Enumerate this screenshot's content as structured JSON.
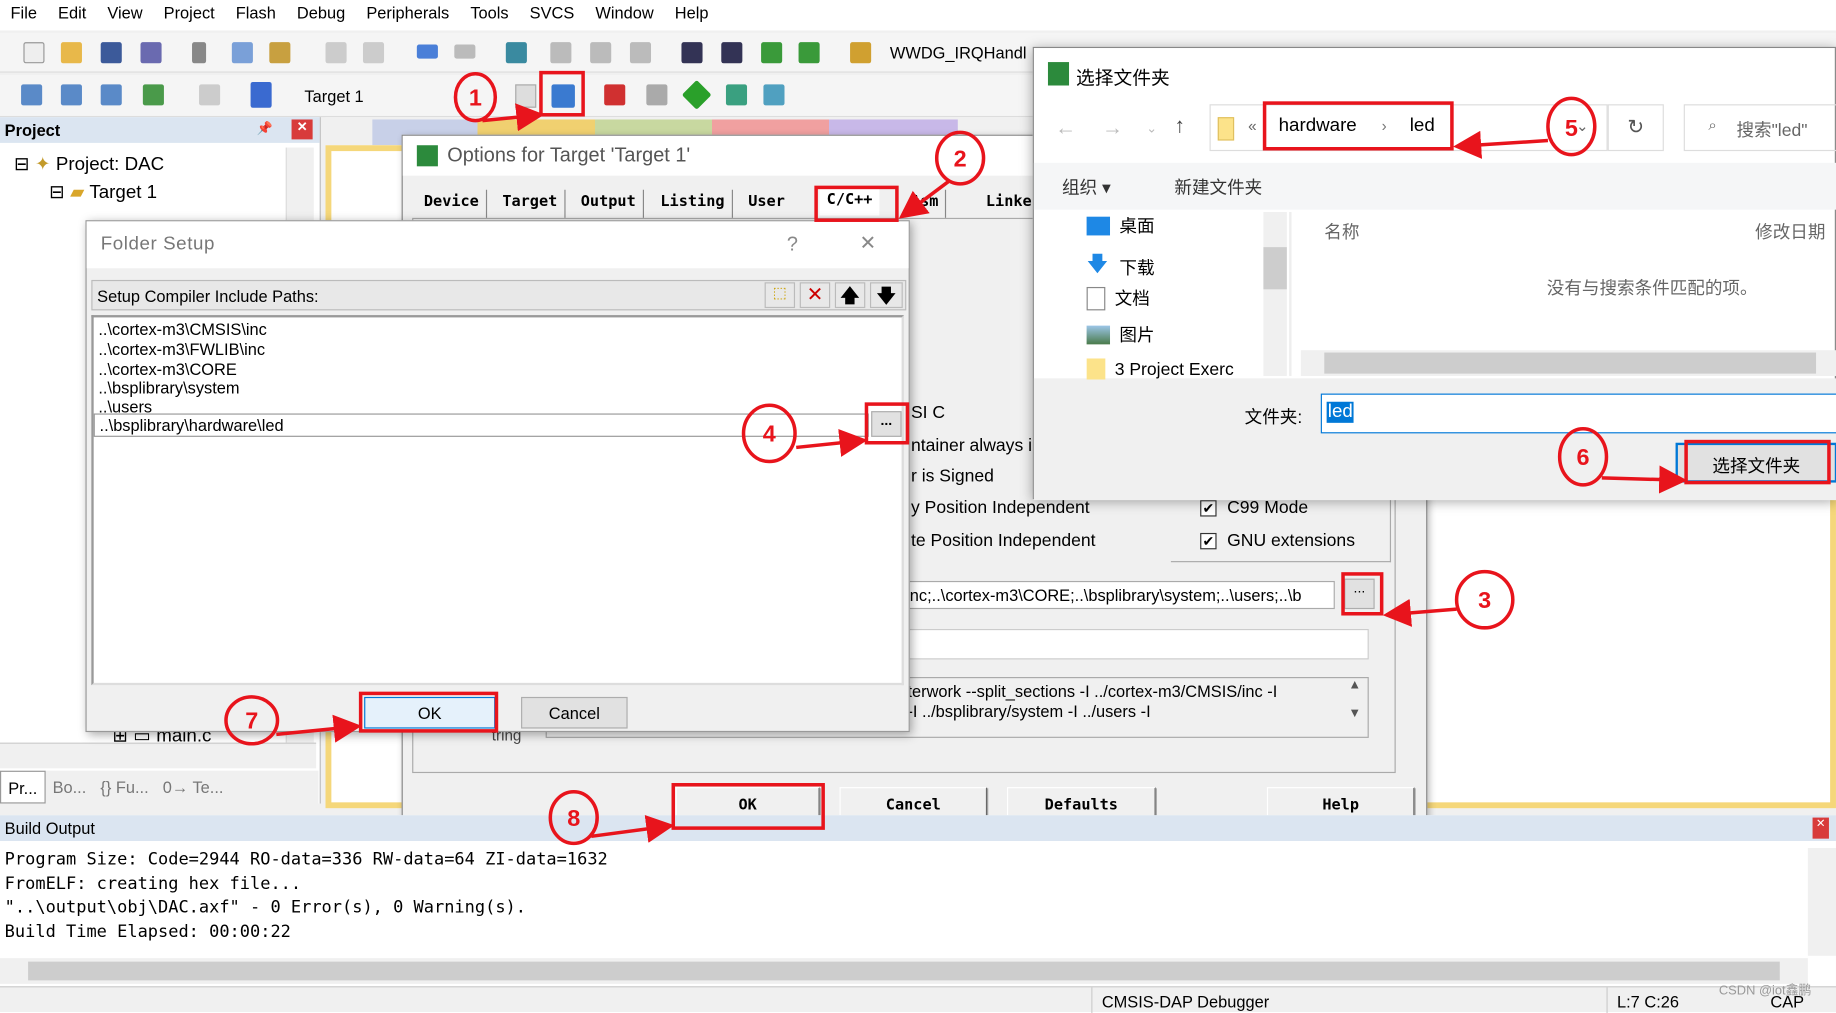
{
  "menu": [
    "File",
    "Edit",
    "View",
    "Project",
    "Flash",
    "Debug",
    "Peripherals",
    "Tools",
    "SVCS",
    "Window",
    "Help"
  ],
  "toolbar": {
    "function_combo": "WWDG_IRQHandl",
    "target_select": "Target 1"
  },
  "project_panel": {
    "title": "Project",
    "root": "Project: DAC",
    "target": "Target 1",
    "partial_item": "main.c",
    "tabs": [
      "Pr...",
      "Bo...",
      "{} Fu...",
      "0→ Te..."
    ]
  },
  "options_dialog": {
    "title": "Options for Target 'Target 1'",
    "tabs": [
      "Device",
      "Target",
      "Output",
      "Listing",
      "User",
      "C/C++",
      "Asm",
      "Linker"
    ],
    "partial_labels": [
      "SI C",
      "ntainer always in",
      "r is Signed",
      "y Position Independent",
      "te Position Independent"
    ],
    "checkboxes": [
      {
        "label": "C99 Mode",
        "checked": true
      },
      {
        "label": "GNU extensions",
        "checked": true
      }
    ],
    "include_paths": "nc;..\\cortex-m3\\CORE;..\\bsplibrary\\system;..\\users;..\\b",
    "browse_label": "...",
    "compiler_string": [
      "terwork --split_sections -I ../cortex-m3/CMSIS/inc -I",
      "-I ../bsplibrary/system -I ../users -I"
    ],
    "compiler_label_partial": "tring",
    "buttons": {
      "ok": "OK",
      "cancel": "Cancel",
      "defaults": "Defaults",
      "help": "Help"
    }
  },
  "folder_setup": {
    "title": "Folder Setup",
    "help": "?",
    "close": "✕",
    "label": "Setup Compiler Include Paths:",
    "paths": [
      "..\\cortex-m3\\CMSIS\\inc",
      "..\\cortex-m3\\FWLIB\\inc",
      "..\\cortex-m3\\CORE",
      "..\\bsplibrary\\system",
      "..\\users"
    ],
    "editing_path": "..\\bsplibrary\\hardware\\led",
    "browse_label": "...",
    "ok": "OK",
    "cancel": "Cancel"
  },
  "file_dialog": {
    "title": "选择文件夹",
    "breadcrumb": [
      "hardware",
      "led"
    ],
    "breadcrumb_overflow": "«",
    "search_placeholder": "搜索\"led\"",
    "organize": "组织 ▾",
    "new_folder": "新建文件夹",
    "nav": [
      "桌面",
      "下载",
      "文档",
      "图片",
      "3 Project Exerc"
    ],
    "columns": [
      "名称",
      "修改日期"
    ],
    "empty_text": "没有与搜索条件匹配的项。",
    "folder_label": "文件夹:",
    "folder_value": "led",
    "select_button": "选择文件夹"
  },
  "build_output": {
    "title": "Build Output",
    "lines": [
      "Program Size: Code=2944 RO-data=336 RW-data=64 ZI-data=1632",
      "FromELF: creating hex file...",
      "\"..\\output\\obj\\DAC.axf\" - 0 Error(s), 0 Warning(s).",
      "Build Time Elapsed:  00:00:22"
    ]
  },
  "status_bar": {
    "debugger": "CMSIS-DAP Debugger",
    "position": "L:7 C:26",
    "caps": "CAP",
    "watermark": "CSDN @iot鑫鹏"
  },
  "annotations": [
    "1",
    "2",
    "3",
    "4",
    "5",
    "6",
    "7",
    "8"
  ],
  "colors": {
    "annotation_red": "#e8141c",
    "selection_blue": "#0078d7",
    "panel_header": "#dbe5f1",
    "editor_border": "#f5d77a"
  }
}
